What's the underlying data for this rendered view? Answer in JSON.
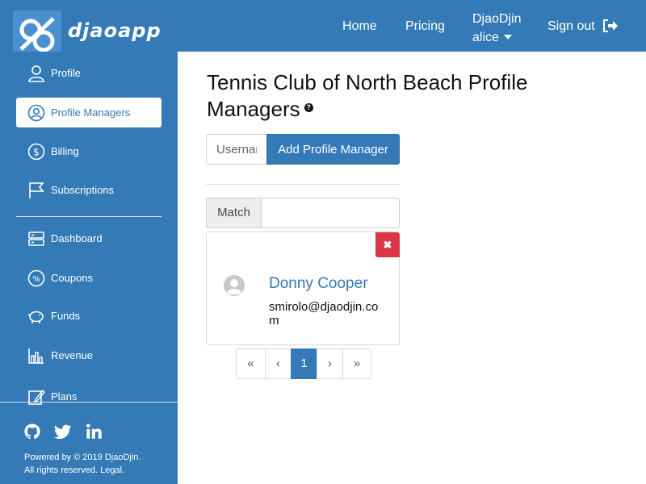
{
  "header": {
    "brand": "djaoapp",
    "nav": {
      "home": "Home",
      "pricing": "Pricing",
      "user_line1": "DjaoDjin",
      "user_line2": "alice",
      "signout": "Sign out"
    }
  },
  "sidebar": {
    "items": [
      {
        "label": "Profile",
        "icon": "user-icon"
      },
      {
        "label": "Profile Managers",
        "icon": "user-circle-icon",
        "active": true
      },
      {
        "label": "Billing",
        "icon": "dollar-icon"
      },
      {
        "label": "Subscriptions",
        "icon": "flag-icon"
      },
      {
        "label": "Dashboard",
        "icon": "server-icon"
      },
      {
        "label": "Coupons",
        "icon": "percent-icon"
      },
      {
        "label": "Funds",
        "icon": "piggy-bank-icon"
      },
      {
        "label": "Revenue",
        "icon": "bar-chart-icon"
      },
      {
        "label": "Plans",
        "icon": "edit-icon"
      }
    ],
    "footer_line1": "Powered by © 2019 DjaoDjin.",
    "footer_line2": "All rights reserved. Legal."
  },
  "main": {
    "title": "Tennis Club of North Beach Profile Managers",
    "username_placeholder": "Username",
    "add_button": "Add Profile Manager",
    "match_label": "Match",
    "match_value": "",
    "managers": [
      {
        "name": "Donny Cooper",
        "email": "smirolo@djaodjin.com"
      }
    ],
    "remove_glyph": "✖",
    "pagination": {
      "first": "«",
      "prev": "‹",
      "current": "1",
      "next": "›",
      "last": "»"
    }
  },
  "colors": {
    "brand": "#337ab7",
    "danger": "#dc3545"
  }
}
